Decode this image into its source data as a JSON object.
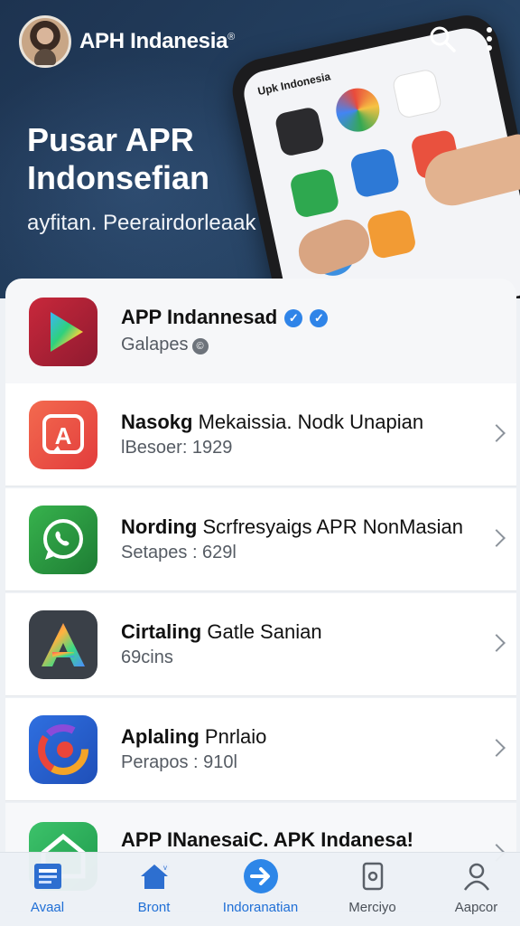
{
  "header": {
    "app_title": "APH Indanesia",
    "title_mark": "®",
    "search_icon": "search-icon",
    "more_icon": "more-vert-icon"
  },
  "hero": {
    "title_line1": "Pusar APR",
    "title_line2": "Indonsefian",
    "subtitle": "ayfitan. Peerairdorleaak",
    "phone_header": "Upk Indonesia"
  },
  "featured": {
    "title": "APP Indannesad",
    "subtitle": "Galapes",
    "icon": "play-triangle-icon",
    "verified_icon": "verified-icon"
  },
  "apps": [
    {
      "title_bold": "Nasokg",
      "title_rest": "Mekaissia. Nodk Unapian",
      "subtitle": "lBesoer: 1929",
      "icon": "red-chat-a-icon"
    },
    {
      "title_bold": "Nording",
      "title_rest": "Scrfresyaigs APR NonMasian",
      "subtitle": "Setapes : 629l",
      "icon": "whatsapp-icon"
    },
    {
      "title_bold": "Cirtaling",
      "title_rest": "Gatle Sanian",
      "subtitle": "69cins",
      "icon": "gradient-a-icon"
    },
    {
      "title_bold": "Aplaling",
      "title_rest": "Pnrlaio",
      "subtitle": "Perapos : 910l",
      "icon": "swirl-logo-icon"
    },
    {
      "title_bold": "APP INanesaiC.",
      "title_rest": "APK Indanesa!",
      "subtitle": "",
      "icon": "green-house-icon"
    }
  ],
  "bottom_nav": [
    {
      "label": "Avaal",
      "icon": "news-icon",
      "active": true
    },
    {
      "label": "Bront",
      "icon": "home-icon",
      "active": false
    },
    {
      "label": "Indoranatian",
      "icon": "arrow-circle-icon",
      "active": false
    },
    {
      "label": "Merciyo",
      "icon": "device-icon",
      "active": false
    },
    {
      "label": "Aapcor",
      "icon": "user-icon",
      "active": false
    }
  ],
  "colors": {
    "hero_bg": "#1d3350",
    "accent_blue": "#1f6fd6",
    "row_bg": "#ffffff"
  }
}
